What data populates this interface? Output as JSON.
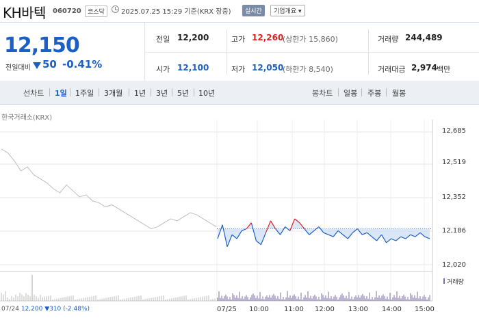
{
  "header": {
    "name": "KH바텍",
    "code": "060720",
    "market": "코스닥",
    "timestamp": "2025.07.25 15:29 기준(KRX 장중)",
    "realtime_label": "실시간",
    "company_label": "기업개요 ▾"
  },
  "summary": {
    "price": "12,150",
    "change_label": "전일대비",
    "change_value": "50",
    "change_percent": "-0.41%",
    "prev_close_label": "전일",
    "prev_close": "12,200",
    "open_label": "시가",
    "open": "12,100",
    "high_label": "고가",
    "high": "12,260",
    "upper_limit": "(상한가 15,860)",
    "low_label": "저가",
    "low": "12,050",
    "lower_limit": "(하한가 8,540)",
    "volume_label": "거래량",
    "volume": "244,489",
    "amount_label": "거래대금",
    "amount": "2,974",
    "amount_unit": "백만"
  },
  "periods": {
    "label": "선차트",
    "items": [
      "1일",
      "1주일",
      "3개월",
      "1년",
      "3년",
      "5년",
      "10년"
    ],
    "active": "1일",
    "candle_label": "봉차트",
    "candle_items": [
      "일봉",
      "주봉",
      "월봉"
    ]
  },
  "chart_data": {
    "type": "line",
    "source_label": "한국거래소(KRX)",
    "y_ticks": [
      "12,685",
      "12,519",
      "12,352",
      "12,186",
      "12,020"
    ],
    "x_ticks": [
      "07/24",
      "07/25",
      "10:00",
      "11:00",
      "12:00",
      "13:00",
      "14:00",
      "15:00"
    ],
    "prev_close": 12200,
    "volume_legend": "거래량",
    "footer_date": "07/24",
    "footer_price": "12,200",
    "footer_change": "▼310 (-2.48%)",
    "prev_day_series": [
      12600,
      12580,
      12540,
      12490,
      12510,
      12470,
      12450,
      12430,
      12400,
      12380,
      12420,
      12390,
      12360,
      12370,
      12340,
      12330,
      12310,
      12320,
      12300,
      12280,
      12260,
      12240,
      12220,
      12200,
      12210,
      12230,
      12250,
      12240,
      12260,
      12280,
      12270,
      12250,
      12230,
      12210
    ],
    "today_series": [
      12150,
      12220,
      12110,
      12170,
      12150,
      12190,
      12200,
      12230,
      12140,
      12120,
      12180,
      12240,
      12200,
      12170,
      12210,
      12190,
      12250,
      12230,
      12200,
      12170,
      12190,
      12210,
      12180,
      12170,
      12160,
      12190,
      12170,
      12150,
      12180,
      12200,
      12170,
      12180,
      12160,
      12140,
      12170,
      12130,
      12150,
      12140,
      12160,
      12150,
      12170,
      12160,
      12180,
      12160,
      12150
    ]
  }
}
